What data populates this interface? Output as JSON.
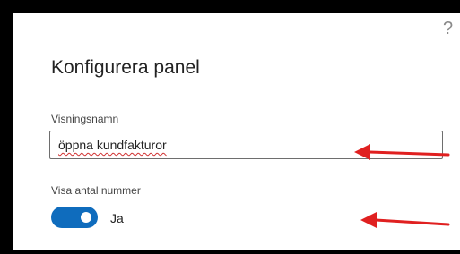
{
  "dialog": {
    "help_glyph": "?",
    "title": "Konfigurera panel"
  },
  "display_name": {
    "label": "Visningsnamn",
    "value": "öppna kundfakturor"
  },
  "show_count": {
    "label": "Visa antal nummer",
    "toggle_on": true,
    "toggle_text": "Ja"
  },
  "colors": {
    "toggle_accent": "#0f6cbd",
    "annotation_arrow": "#e02020",
    "frame": "#000000"
  }
}
